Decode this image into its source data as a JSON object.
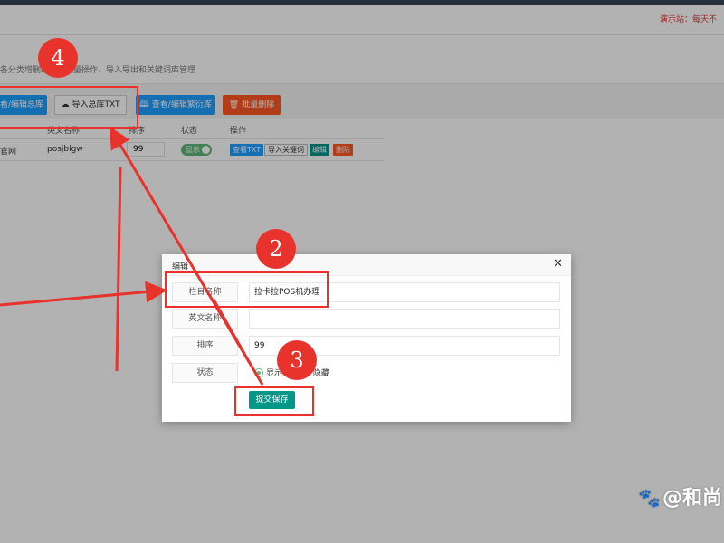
{
  "header": {
    "demo_note": "演示站：每天不"
  },
  "page": {
    "description": "各分类增删改查，批量操作、导入导出和关键词库管理"
  },
  "toolbar": {
    "view_edit_main": "看/编辑总库",
    "import_txt": "导入总库TXT",
    "view_edit_derived": "查看/编辑繁衍库",
    "batch_delete": "批量删除"
  },
  "table": {
    "headers": {
      "english_name": "英文名称",
      "sort": "排序",
      "status": "状态",
      "actions": "操作"
    },
    "rows": [
      {
        "name": "官网",
        "english_name": "posjblgw",
        "sort": "99",
        "status": "显示",
        "actions": {
          "view_txt": "查看TXT",
          "import_keywords": "导入关键词",
          "edit": "编辑",
          "delete": "删除"
        }
      }
    ]
  },
  "modal": {
    "title": "编辑",
    "close": "✕",
    "fields": {
      "column_name_label": "栏目名称",
      "column_name_value": "拉卡拉POS机办理",
      "english_name_label": "英文名称",
      "english_name_value": "",
      "sort_label": "排序",
      "sort_value": "99",
      "status_label": "状态"
    },
    "status_options": {
      "show": "显示",
      "hide": "隐藏",
      "selected": "显示"
    },
    "submit": "提交保存"
  },
  "annotations": {
    "step_2": "2",
    "step_3": "3",
    "step_4": "4",
    "color": "#e8332d"
  },
  "watermark": {
    "text": "@和尚"
  },
  "icons": {
    "import": "cloud-upload-icon",
    "view": "book-icon",
    "delete": "trash-icon",
    "close": "close-icon",
    "watermark": "paw-icon"
  }
}
